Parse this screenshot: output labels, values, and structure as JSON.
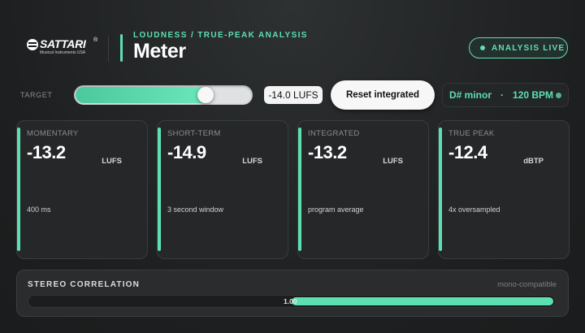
{
  "brand": {
    "name": "SATTARI",
    "registered": "®",
    "tagline": "Musical Instruments USA"
  },
  "header": {
    "subtitle": "LOUDNESS / TRUE-PEAK ANALYSIS",
    "title": "Meter",
    "status": "ANALYSIS LIVE"
  },
  "controls": {
    "target_label": "TARGET",
    "target_value": "-14.0 LUFS",
    "target_slider_fraction": 0.74,
    "reset_label": "Reset integrated",
    "key": "D# minor",
    "separator": "·",
    "tempo": "120 BPM"
  },
  "meters": [
    {
      "label": "MOMENTARY",
      "value": "-13.2",
      "unit": "LUFS",
      "note": "400 ms"
    },
    {
      "label": "SHORT-TERM",
      "value": "-14.9",
      "unit": "LUFS",
      "note": "3 second window"
    },
    {
      "label": "INTEGRATED",
      "value": "-13.2",
      "unit": "LUFS",
      "note": "program average"
    },
    {
      "label": "TRUE PEAK",
      "value": "-12.4",
      "unit": "dBTP",
      "note": "4x oversampled"
    }
  ],
  "stereo": {
    "label": "STEREO CORRELATION",
    "hint": "mono-compatible",
    "value_text": "1.00",
    "value": 1.0
  },
  "colors": {
    "accent": "#5de0b0",
    "background": "#1d1f20",
    "card": "#252728"
  },
  "icons": [
    "live-dot-icon",
    "brand-logo-icon",
    "sync-dot-icon"
  ]
}
